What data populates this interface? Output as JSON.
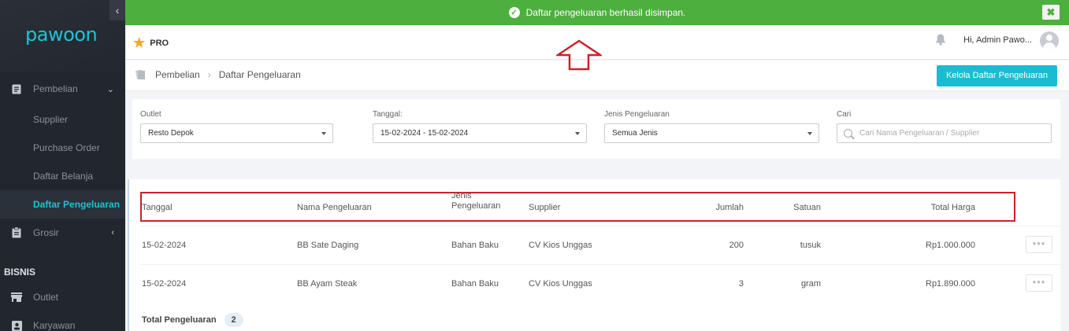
{
  "sidebar": {
    "logo": "pawoon",
    "collapse_icon": "chevron-left-icon",
    "items": [
      {
        "label": "Pembelian",
        "icon": "receipt-icon"
      },
      {
        "label": "Supplier"
      },
      {
        "label": "Purchase Order"
      },
      {
        "label": "Daftar Belanja"
      },
      {
        "label": "Daftar Pengeluaran"
      },
      {
        "label": "Grosir",
        "icon": "clipboard-icon"
      },
      {
        "label": "Outlet",
        "icon": "store-icon"
      },
      {
        "label": "Karyawan",
        "icon": "person-icon"
      }
    ],
    "section_bisnis": "BISNIS",
    "active_item": "Daftar Pengeluaran",
    "accent": "#1fc2d5"
  },
  "notification": {
    "message": "Daftar pengeluaran berhasil disimpan.",
    "close": "✖",
    "color": "#4caf3e"
  },
  "header": {
    "plan": "PRO",
    "greeting": "Hi, Admin Pawo..."
  },
  "breadcrumb": {
    "parent": "Pembelian",
    "current": "Daftar Pengeluaran",
    "action_button": "Kelola Daftar Pengeluaran"
  },
  "filters": {
    "outlet": {
      "label": "Outlet",
      "value": "Resto Depok"
    },
    "tanggal": {
      "label": "Tanggal:",
      "value": "15-02-2024 - 15-02-2024"
    },
    "jenis": {
      "label": "Jenis Pengeluaran",
      "value": "Semua Jenis"
    },
    "cari": {
      "label": "Cari",
      "placeholder": "Cari Nama Pengeluaran / Supplier"
    }
  },
  "table": {
    "headers": {
      "tanggal": "Tanggal",
      "nama": "Nama Pengeluaran",
      "jenis_1": "Jenis",
      "jenis_2": "Pengeluaran",
      "supplier": "Supplier",
      "jumlah": "Jumlah",
      "satuan": "Satuan",
      "total": "Total Harga"
    },
    "rows": [
      {
        "tanggal": "15-02-2024",
        "nama": "BB Sate Daging",
        "jenis": "Bahan Baku",
        "supplier": "CV Kios Unggas",
        "jumlah": "200",
        "satuan": "tusuk",
        "total": "Rp1.000.000",
        "more": "•••"
      },
      {
        "tanggal": "15-02-2024",
        "nama": "BB Ayam Steak",
        "jenis": "Bahan Baku",
        "supplier": "CV Kios Unggas",
        "jumlah": "3",
        "satuan": "gram",
        "total": "Rp1.890.000",
        "more": "•••"
      }
    ],
    "total_label": "Total Pengeluaran",
    "total_count": "2"
  },
  "annotation": {
    "color": "#cc2229"
  }
}
